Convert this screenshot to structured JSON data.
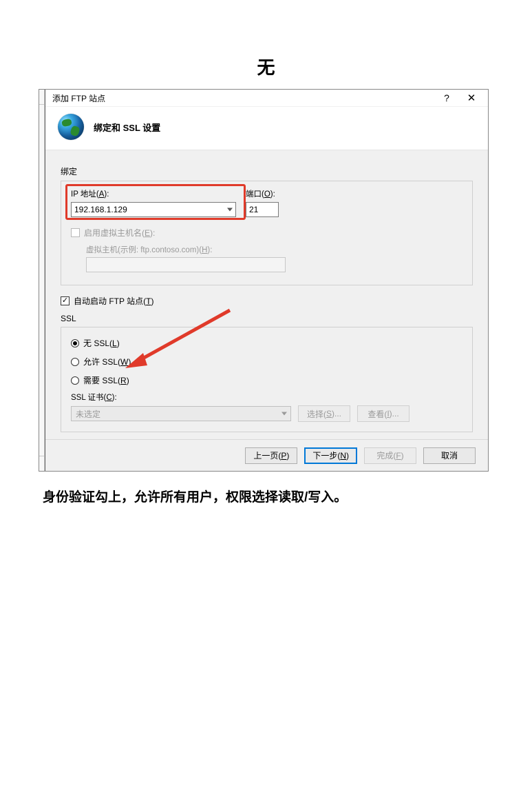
{
  "page_title_top": "无",
  "caption_below": "身份验证勾上，允许所有用户，权限选择读取/写入。",
  "dialog": {
    "title": "添加 FTP 站点",
    "header": "绑定和 SSL 设置",
    "binding": {
      "group_label": "绑定",
      "ip_label_pre": "IP 地址(",
      "ip_label_key": "A",
      "ip_label_post": "):",
      "ip_value": "192.168.1.129",
      "port_label_pre": "端口(",
      "port_label_key": "O",
      "port_label_post": "):",
      "port_value": "21",
      "enable_vh_pre": "启用虚拟主机名(",
      "enable_vh_key": "E",
      "enable_vh_post": "):",
      "vh_hint_pre": "虚拟主机(示例: ftp.contoso.com)(",
      "vh_hint_key": "H",
      "vh_hint_post": "):"
    },
    "autostart_pre": "自动启动 FTP 站点(",
    "autostart_key": "T",
    "autostart_post": ")",
    "ssl": {
      "group_label": "SSL",
      "no_ssl_pre": "无 SSL(",
      "no_ssl_key": "L",
      "no_ssl_post": ")",
      "allow_ssl_pre": "允许 SSL(",
      "allow_ssl_key": "W",
      "allow_ssl_post": ")",
      "require_ssl_pre": "需要 SSL(",
      "require_ssl_key": "R",
      "require_ssl_post": ")",
      "cert_label_pre": "SSL 证书(",
      "cert_label_key": "C",
      "cert_label_post": "):",
      "cert_value": "未选定",
      "select_btn_pre": "选择(",
      "select_btn_key": "S",
      "select_btn_post": ")...",
      "view_btn_pre": "查看(",
      "view_btn_key": "I",
      "view_btn_post": ")..."
    },
    "buttons": {
      "prev_pre": "上一页(",
      "prev_key": "P",
      "prev_post": ")",
      "next_pre": "下一步(",
      "next_key": "N",
      "next_post": ")",
      "finish_pre": "完成(",
      "finish_key": "F",
      "finish_post": ")",
      "cancel": "取消"
    }
  }
}
